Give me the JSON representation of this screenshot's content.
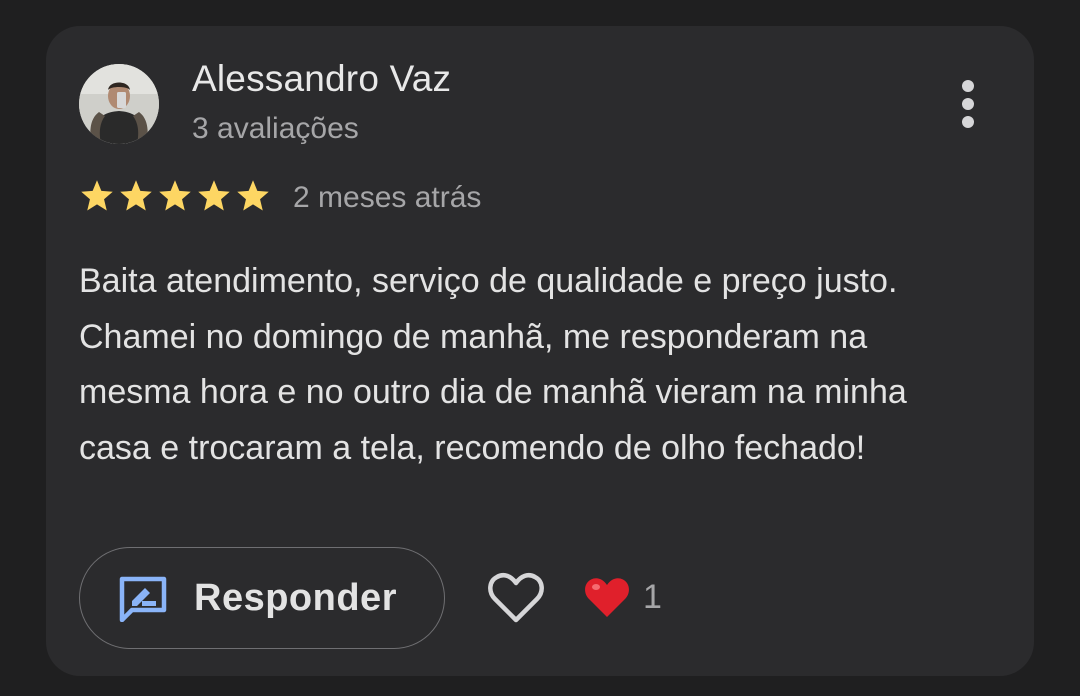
{
  "review": {
    "author_name": "Alessandro Vaz",
    "author_reviews": "3 avaliações",
    "rating": 5,
    "rating_max": 5,
    "time_ago": "2 meses atrás",
    "text": "Baita atendimento, serviço de qualidade e preço justo. Chamei no domingo de manhã, me responderam na mesma hora e no outro dia de manhã vieram na minha casa e trocaram a tela, recomendo de olho fechado!"
  },
  "actions": {
    "reply_label": "Responder",
    "reply_icon": "rate-review-icon",
    "like_icon": "heart-outline-icon",
    "more_icon": "more-vertical-icon"
  },
  "reactions": {
    "icon": "heart-emoji",
    "count": "1"
  },
  "colors": {
    "background": "#1f1f20",
    "card": "#2b2b2d",
    "star": "#fdd663",
    "accent_blue": "#8ab4f8",
    "heart_red": "#e0202b",
    "text_primary": "#e3e3e3",
    "text_secondary": "#a6a6a8"
  }
}
